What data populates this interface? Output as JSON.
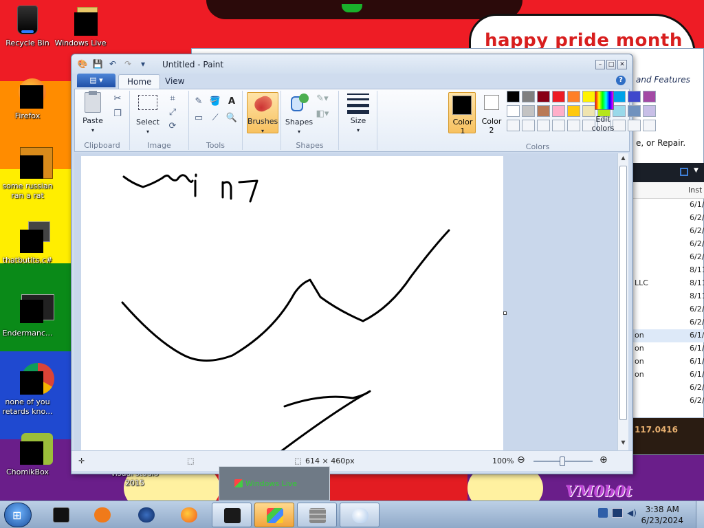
{
  "desktop": {
    "banner_text": "happy pride month",
    "watermark_text": "VM0b0t",
    "icons": [
      {
        "label": "Recycle Bin",
        "icon": "recycle-bin-icon"
      },
      {
        "label": "Windows Live",
        "icon": "folder-icon"
      },
      {
        "label": "Firefox",
        "icon": "firefox-icon"
      },
      {
        "label": "some russian ran a rat",
        "icon": "app-icon"
      },
      {
        "label": "thatbutits.c#",
        "icon": "stack-icon"
      },
      {
        "label": "Endermanc...",
        "icon": "console-icon"
      },
      {
        "label": "none of you retards kno...",
        "icon": "chrome-icon"
      },
      {
        "label": "ChomikBox",
        "icon": "hamster-icon"
      },
      {
        "label": "visual studio 2015",
        "icon": "vs-icon"
      }
    ]
  },
  "background_window": {
    "title_fragment": "and Features",
    "hint_fragment": "e, or Repair.",
    "column_header": "Inst",
    "rows": [
      {
        "name": "",
        "date": "6/1/"
      },
      {
        "name": "",
        "date": "6/2/"
      },
      {
        "name": "",
        "date": "6/2/"
      },
      {
        "name": "",
        "date": "6/2/"
      },
      {
        "name": "",
        "date": "6/2/"
      },
      {
        "name": "",
        "date": "8/11"
      },
      {
        "name": "LLC",
        "date": "8/11"
      },
      {
        "name": "",
        "date": "8/11"
      },
      {
        "name": "",
        "date": "6/2/"
      },
      {
        "name": "",
        "date": "6/2/"
      },
      {
        "name": "on",
        "date": "6/1/"
      },
      {
        "name": "on",
        "date": "6/1/"
      },
      {
        "name": "on",
        "date": "6/1/"
      },
      {
        "name": "on",
        "date": "6/1/"
      },
      {
        "name": "",
        "date": "6/2/"
      },
      {
        "name": "",
        "date": "6/2/"
      }
    ],
    "status_value": "117.0416"
  },
  "paint": {
    "window_title": "Untitled - Paint",
    "tabs": [
      "Home",
      "View"
    ],
    "ribbon": {
      "clipboard": {
        "label": "Clipboard",
        "paste": "Paste"
      },
      "image": {
        "label": "Image",
        "select": "Select"
      },
      "tools": {
        "label": "Tools"
      },
      "brushes": "Brushes",
      "shapes": {
        "label": "Shapes",
        "button": "Shapes"
      },
      "size": "Size",
      "color1": "Color\n1",
      "color1_a": "Color",
      "color1_b": "1",
      "color2_a": "Color",
      "color2_b": "2",
      "colors_label": "Colors",
      "edit_colors_a": "Edit",
      "edit_colors_b": "colors"
    },
    "palette": [
      "#000000",
      "#7f7f7f",
      "#880015",
      "#ed1c24",
      "#ff7f27",
      "#fff200",
      "#22b14c",
      "#00a2e8",
      "#3f48cc",
      "#a349a4",
      "#ffffff",
      "#c3c3c3",
      "#b97a57",
      "#ffaec9",
      "#ffc90e",
      "#efe4b0",
      "#b5e61d",
      "#99d9ea",
      "#7092be",
      "#c8bfe7"
    ],
    "color1": "#000000",
    "color2": "#ffffff",
    "status": {
      "dimensions": "614 × 460px",
      "zoom": "100%"
    }
  },
  "taskbar": {
    "time": "3:38 AM",
    "date": "6/23/2024",
    "preview_label": "Windows Live",
    "items": [
      {
        "name": "media-player",
        "color": "#f07a1a"
      },
      {
        "name": "globe",
        "color": "#1b3e7a"
      },
      {
        "name": "firefox",
        "color": "#f26b1d"
      },
      {
        "name": "terminal",
        "color": "#1a1a1a"
      },
      {
        "name": "windows-live",
        "color": "#f2a43a"
      },
      {
        "name": "firewall",
        "color": "#8a8a8a"
      },
      {
        "name": "paint",
        "color": "#d9e6f5"
      }
    ]
  }
}
